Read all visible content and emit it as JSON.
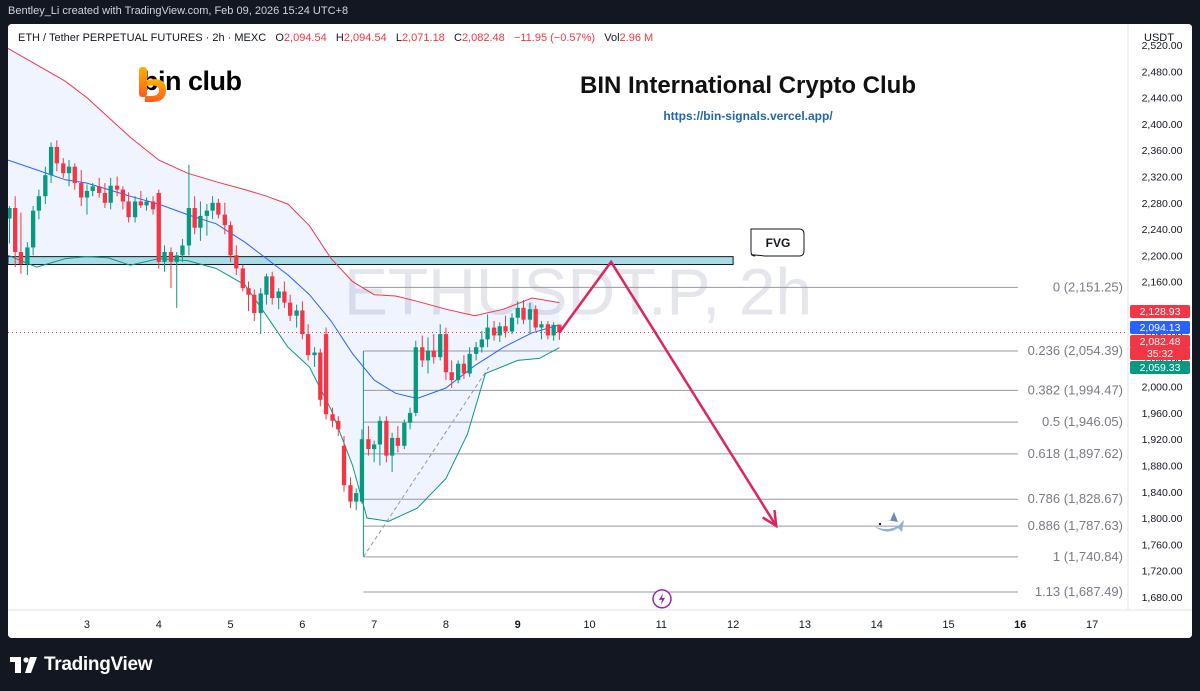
{
  "header": {
    "attribution": "Bentley_Li created with TradingView.com, Feb 09, 2026 15:24 UTC+8"
  },
  "legend": {
    "symbol": "ETH / Tether PERPETUAL FUTURES · 2h · MEXC",
    "open_label": "O",
    "open": "2,094.54",
    "high_label": "H",
    "high": "2,094.54",
    "low_label": "L",
    "low": "2,071.18",
    "close_label": "C",
    "close": "2,082.48",
    "change": "−11.95 (−0.57%)",
    "vol_label": "Vol",
    "vol": "2.96 M"
  },
  "brand": {
    "name": "bin club",
    "title": "BIN International Crypto Club",
    "url": "https://bin-signals.vercel.app/"
  },
  "currency": "USDT",
  "watermark": "ETHUSDT.P, 2h",
  "footer": {
    "logo_text": "TradingView"
  },
  "colors": {
    "up": "#089981",
    "down": "#f23645",
    "bb_upper": "#f23645",
    "bb_lower": "#089981",
    "bb_basis": "#2962ff",
    "fvg": "#a8dde7",
    "arrow": "#e0245e"
  },
  "chart_data": {
    "type": "candlestick",
    "title": "",
    "xlabel": "",
    "ylabel": "",
    "y_axis": {
      "ylim": [
        1660,
        2540
      ],
      "ticks": [
        1680,
        1720,
        1760,
        1800,
        1840,
        1880,
        1920,
        1960,
        2000,
        2040,
        2080,
        2120,
        2160,
        2200,
        2240,
        2280,
        2320,
        2360,
        2400,
        2440,
        2480,
        2520
      ],
      "tick_labels": [
        "1,680.00",
        "1,720.00",
        "1,760.00",
        "1,800.00",
        "1,840.00",
        "1,880.00",
        "1,920.00",
        "1,960.00",
        "2,000.00",
        "2,040.00",
        "2,080.00",
        "2,120.00",
        "2,160.00",
        "2,200.00",
        "2,240.00",
        "2,280.00",
        "2,320.00",
        "2,360.00",
        "2,400.00",
        "2,440.00",
        "2,480.00",
        "2,520.00"
      ]
    },
    "x_axis": {
      "ticks": [
        {
          "label": "3",
          "day": 3
        },
        {
          "label": "4",
          "day": 4
        },
        {
          "label": "5",
          "day": 5
        },
        {
          "label": "6",
          "day": 6
        },
        {
          "label": "7",
          "day": 7
        },
        {
          "label": "8",
          "day": 8
        },
        {
          "label": "9",
          "day": 9
        },
        {
          "label": "10",
          "day": 10
        },
        {
          "label": "11",
          "day": 11
        },
        {
          "label": "12",
          "day": 12
        },
        {
          "label": "13",
          "day": 13
        },
        {
          "label": "14",
          "day": 14
        },
        {
          "label": "15",
          "day": 15
        },
        {
          "label": "16",
          "day": 16
        },
        {
          "label": "17",
          "day": 17
        }
      ],
      "xlim_days": [
        1.9,
        17.5
      ]
    },
    "candles": [
      {
        "d": 1.92,
        "o": 2256,
        "h": 2275,
        "l": 2218,
        "c": 2272
      },
      {
        "d": 2.0,
        "o": 2272,
        "h": 2290,
        "l": 2182,
        "c": 2205
      },
      {
        "d": 2.08,
        "o": 2205,
        "h": 2265,
        "l": 2172,
        "c": 2187
      },
      {
        "d": 2.17,
        "o": 2187,
        "h": 2220,
        "l": 2170,
        "c": 2212
      },
      {
        "d": 2.25,
        "o": 2212,
        "h": 2275,
        "l": 2200,
        "c": 2268
      },
      {
        "d": 2.33,
        "o": 2268,
        "h": 2300,
        "l": 2255,
        "c": 2290
      },
      {
        "d": 2.42,
        "o": 2290,
        "h": 2335,
        "l": 2278,
        "c": 2322
      },
      {
        "d": 2.5,
        "o": 2322,
        "h": 2372,
        "l": 2310,
        "c": 2365
      },
      {
        "d": 2.58,
        "o": 2365,
        "h": 2375,
        "l": 2328,
        "c": 2340
      },
      {
        "d": 2.67,
        "o": 2340,
        "h": 2348,
        "l": 2318,
        "c": 2325
      },
      {
        "d": 2.75,
        "o": 2325,
        "h": 2345,
        "l": 2305,
        "c": 2335
      },
      {
        "d": 2.83,
        "o": 2335,
        "h": 2340,
        "l": 2300,
        "c": 2310
      },
      {
        "d": 2.92,
        "o": 2310,
        "h": 2330,
        "l": 2275,
        "c": 2288
      },
      {
        "d": 3.0,
        "o": 2288,
        "h": 2308,
        "l": 2262,
        "c": 2298
      },
      {
        "d": 3.08,
        "o": 2298,
        "h": 2310,
        "l": 2290,
        "c": 2305
      },
      {
        "d": 3.17,
        "o": 2305,
        "h": 2318,
        "l": 2288,
        "c": 2295
      },
      {
        "d": 3.25,
        "o": 2295,
        "h": 2310,
        "l": 2272,
        "c": 2280
      },
      {
        "d": 3.33,
        "o": 2280,
        "h": 2318,
        "l": 2270,
        "c": 2306
      },
      {
        "d": 3.42,
        "o": 2306,
        "h": 2320,
        "l": 2290,
        "c": 2300
      },
      {
        "d": 3.5,
        "o": 2300,
        "h": 2305,
        "l": 2270,
        "c": 2282
      },
      {
        "d": 3.58,
        "o": 2282,
        "h": 2296,
        "l": 2250,
        "c": 2258
      },
      {
        "d": 3.67,
        "o": 2258,
        "h": 2290,
        "l": 2250,
        "c": 2282
      },
      {
        "d": 3.75,
        "o": 2282,
        "h": 2298,
        "l": 2272,
        "c": 2276
      },
      {
        "d": 3.83,
        "o": 2276,
        "h": 2288,
        "l": 2268,
        "c": 2282
      },
      {
        "d": 3.92,
        "o": 2282,
        "h": 2290,
        "l": 2262,
        "c": 2270
      },
      {
        "d": 4.0,
        "o": 2295,
        "h": 2300,
        "l": 2180,
        "c": 2190
      },
      {
        "d": 4.08,
        "o": 2190,
        "h": 2215,
        "l": 2175,
        "c": 2205
      },
      {
        "d": 4.17,
        "o": 2205,
        "h": 2212,
        "l": 2150,
        "c": 2190
      },
      {
        "d": 4.25,
        "o": 2190,
        "h": 2205,
        "l": 2120,
        "c": 2200
      },
      {
        "d": 4.33,
        "o": 2200,
        "h": 2225,
        "l": 2190,
        "c": 2215
      },
      {
        "d": 4.42,
        "o": 2215,
        "h": 2338,
        "l": 2200,
        "c": 2272
      },
      {
        "d": 4.5,
        "o": 2272,
        "h": 2290,
        "l": 2232,
        "c": 2242
      },
      {
        "d": 4.58,
        "o": 2242,
        "h": 2282,
        "l": 2222,
        "c": 2260
      },
      {
        "d": 4.67,
        "o": 2260,
        "h": 2278,
        "l": 2230,
        "c": 2268
      },
      {
        "d": 4.75,
        "o": 2268,
        "h": 2290,
        "l": 2255,
        "c": 2280
      },
      {
        "d": 4.83,
        "o": 2280,
        "h": 2286,
        "l": 2256,
        "c": 2262
      },
      {
        "d": 4.92,
        "o": 2262,
        "h": 2280,
        "l": 2232,
        "c": 2246
      },
      {
        "d": 5.0,
        "o": 2246,
        "h": 2252,
        "l": 2190,
        "c": 2200
      },
      {
        "d": 5.08,
        "o": 2200,
        "h": 2215,
        "l": 2170,
        "c": 2180
      },
      {
        "d": 5.17,
        "o": 2180,
        "h": 2186,
        "l": 2145,
        "c": 2150
      },
      {
        "d": 5.25,
        "o": 2150,
        "h": 2160,
        "l": 2115,
        "c": 2140
      },
      {
        "d": 5.33,
        "o": 2140,
        "h": 2148,
        "l": 2100,
        "c": 2112
      },
      {
        "d": 5.42,
        "o": 2112,
        "h": 2150,
        "l": 2080,
        "c": 2142
      },
      {
        "d": 5.5,
        "o": 2140,
        "h": 2172,
        "l": 2125,
        "c": 2168
      },
      {
        "d": 5.58,
        "o": 2168,
        "h": 2175,
        "l": 2125,
        "c": 2135
      },
      {
        "d": 5.67,
        "o": 2135,
        "h": 2150,
        "l": 2118,
        "c": 2145
      },
      {
        "d": 5.75,
        "o": 2145,
        "h": 2160,
        "l": 2120,
        "c": 2128
      },
      {
        "d": 5.83,
        "o": 2128,
        "h": 2140,
        "l": 2100,
        "c": 2108
      },
      {
        "d": 5.92,
        "o": 2108,
        "h": 2125,
        "l": 2090,
        "c": 2116
      },
      {
        "d": 6.0,
        "o": 2116,
        "h": 2130,
        "l": 2072,
        "c": 2080
      },
      {
        "d": 6.08,
        "o": 2080,
        "h": 2095,
        "l": 2040,
        "c": 2048
      },
      {
        "d": 6.17,
        "o": 2048,
        "h": 2060,
        "l": 2030,
        "c": 2052
      },
      {
        "d": 6.25,
        "o": 2052,
        "h": 2058,
        "l": 1970,
        "c": 1980
      },
      {
        "d": 6.33,
        "o": 2080,
        "h": 2090,
        "l": 1950,
        "c": 1958
      },
      {
        "d": 6.42,
        "o": 1958,
        "h": 1968,
        "l": 1938,
        "c": 1948
      },
      {
        "d": 6.5,
        "o": 1948,
        "h": 1955,
        "l": 1925,
        "c": 1935
      },
      {
        "d": 6.58,
        "o": 1910,
        "h": 1925,
        "l": 1840,
        "c": 1850
      },
      {
        "d": 6.67,
        "o": 1850,
        "h": 1862,
        "l": 1815,
        "c": 1825
      },
      {
        "d": 6.75,
        "o": 1825,
        "h": 1845,
        "l": 1812,
        "c": 1838
      },
      {
        "d": 6.83,
        "o": 1825,
        "h": 1935,
        "l": 1822,
        "c": 1920
      },
      {
        "d": 6.92,
        "o": 1920,
        "h": 1940,
        "l": 1895,
        "c": 1905
      },
      {
        "d": 7.0,
        "o": 1905,
        "h": 1918,
        "l": 1885,
        "c": 1912
      },
      {
        "d": 7.08,
        "o": 1912,
        "h": 1955,
        "l": 1880,
        "c": 1948
      },
      {
        "d": 7.17,
        "o": 1948,
        "h": 1955,
        "l": 1885,
        "c": 1895
      },
      {
        "d": 7.25,
        "o": 1895,
        "h": 1930,
        "l": 1870,
        "c": 1922
      },
      {
        "d": 7.33,
        "o": 1922,
        "h": 1940,
        "l": 1900,
        "c": 1910
      },
      {
        "d": 7.42,
        "o": 1910,
        "h": 1950,
        "l": 1905,
        "c": 1945
      },
      {
        "d": 7.5,
        "o": 1945,
        "h": 1968,
        "l": 1935,
        "c": 1960
      },
      {
        "d": 7.58,
        "o": 1960,
        "h": 2070,
        "l": 1955,
        "c": 2060
      },
      {
        "d": 7.67,
        "o": 2060,
        "h": 2078,
        "l": 2030,
        "c": 2040
      },
      {
        "d": 7.75,
        "o": 2040,
        "h": 2075,
        "l": 2020,
        "c": 2055
      },
      {
        "d": 7.83,
        "o": 2055,
        "h": 2080,
        "l": 2035,
        "c": 2045
      },
      {
        "d": 7.92,
        "o": 2045,
        "h": 2095,
        "l": 2040,
        "c": 2080
      },
      {
        "d": 8.0,
        "o": 2080,
        "h": 2090,
        "l": 2010,
        "c": 2022
      },
      {
        "d": 8.08,
        "o": 2022,
        "h": 2040,
        "l": 1998,
        "c": 2010
      },
      {
        "d": 8.17,
        "o": 2010,
        "h": 2040,
        "l": 2005,
        "c": 2035
      },
      {
        "d": 8.25,
        "o": 2035,
        "h": 2048,
        "l": 2012,
        "c": 2020
      },
      {
        "d": 8.33,
        "o": 2020,
        "h": 2060,
        "l": 2015,
        "c": 2050
      },
      {
        "d": 8.42,
        "o": 2050,
        "h": 2068,
        "l": 2040,
        "c": 2060
      },
      {
        "d": 8.5,
        "o": 2060,
        "h": 2085,
        "l": 2052,
        "c": 2072
      },
      {
        "d": 8.58,
        "o": 2072,
        "h": 2110,
        "l": 2060,
        "c": 2090
      },
      {
        "d": 8.67,
        "o": 2090,
        "h": 2100,
        "l": 2070,
        "c": 2078
      },
      {
        "d": 8.75,
        "o": 2078,
        "h": 2098,
        "l": 2068,
        "c": 2092
      },
      {
        "d": 8.83,
        "o": 2092,
        "h": 2108,
        "l": 2075,
        "c": 2084
      },
      {
        "d": 8.92,
        "o": 2084,
        "h": 2112,
        "l": 2080,
        "c": 2105
      },
      {
        "d": 9.0,
        "o": 2105,
        "h": 2130,
        "l": 2095,
        "c": 2120
      },
      {
        "d": 9.08,
        "o": 2120,
        "h": 2132,
        "l": 2095,
        "c": 2102
      },
      {
        "d": 9.17,
        "o": 2102,
        "h": 2128,
        "l": 2080,
        "c": 2118
      },
      {
        "d": 9.25,
        "o": 2118,
        "h": 2124,
        "l": 2085,
        "c": 2090
      },
      {
        "d": 9.33,
        "o": 2090,
        "h": 2100,
        "l": 2072,
        "c": 2095
      },
      {
        "d": 9.42,
        "o": 2095,
        "h": 2100,
        "l": 2072,
        "c": 2078
      },
      {
        "d": 9.5,
        "o": 2078,
        "h": 2098,
        "l": 2070,
        "c": 2094
      },
      {
        "d": 9.58,
        "o": 2094.54,
        "h": 2094.54,
        "l": 2071.18,
        "c": 2082.48
      }
    ],
    "bollinger": {
      "upper": [
        [
          1.9,
          2515
        ],
        [
          2.3,
          2490
        ],
        [
          2.7,
          2465
        ],
        [
          3.0,
          2440
        ],
        [
          3.3,
          2410
        ],
        [
          3.6,
          2380
        ],
        [
          4.0,
          2345
        ],
        [
          4.4,
          2325
        ],
        [
          4.8,
          2312
        ],
        [
          5.2,
          2300
        ],
        [
          5.5,
          2290
        ],
        [
          5.8,
          2278
        ],
        [
          6.1,
          2245
        ],
        [
          6.4,
          2195
        ],
        [
          6.7,
          2160
        ],
        [
          7.0,
          2140
        ],
        [
          7.3,
          2138
        ],
        [
          7.6,
          2130
        ],
        [
          8.0,
          2118
        ],
        [
          8.4,
          2108
        ],
        [
          8.8,
          2118
        ],
        [
          9.2,
          2135
        ],
        [
          9.58,
          2128
        ]
      ],
      "basis": [
        [
          1.9,
          2345
        ],
        [
          2.3,
          2330
        ],
        [
          2.7,
          2315
        ],
        [
          3.0,
          2310
        ],
        [
          3.3,
          2300
        ],
        [
          3.6,
          2290
        ],
        [
          4.0,
          2278
        ],
        [
          4.4,
          2262
        ],
        [
          4.8,
          2248
        ],
        [
          5.2,
          2220
        ],
        [
          5.5,
          2195
        ],
        [
          5.8,
          2170
        ],
        [
          6.1,
          2140
        ],
        [
          6.4,
          2100
        ],
        [
          6.7,
          2050
        ],
        [
          7.0,
          2010
        ],
        [
          7.3,
          1990
        ],
        [
          7.6,
          1982
        ],
        [
          8.0,
          1998
        ],
        [
          8.4,
          2032
        ],
        [
          8.8,
          2060
        ],
        [
          9.2,
          2082
        ],
        [
          9.58,
          2094.13
        ]
      ],
      "lower": [
        [
          1.9,
          2200
        ],
        [
          2.3,
          2182
        ],
        [
          2.7,
          2195
        ],
        [
          3.0,
          2198
        ],
        [
          3.3,
          2196
        ],
        [
          3.6,
          2185
        ],
        [
          4.0,
          2195
        ],
        [
          4.4,
          2192
        ],
        [
          4.8,
          2180
        ],
        [
          5.2,
          2155
        ],
        [
          5.5,
          2108
        ],
        [
          5.8,
          2060
        ],
        [
          6.1,
          2030
        ],
        [
          6.4,
          1965
        ],
        [
          6.7,
          1880
        ],
        [
          6.9,
          1800
        ],
        [
          7.2,
          1795
        ],
        [
          7.6,
          1815
        ],
        [
          8.0,
          1860
        ],
        [
          8.3,
          1928
        ],
        [
          8.55,
          2020
        ],
        [
          9.0,
          2040
        ],
        [
          9.3,
          2043
        ],
        [
          9.58,
          2059.33
        ]
      ]
    },
    "fvg": {
      "label": "FVG",
      "top": 2198,
      "bottom": 2186,
      "x_start_day": 1.9,
      "x_end_day": 12.0
    },
    "fibonacci": {
      "start_day": 6.85,
      "levels": [
        {
          "ratio": "0",
          "price": 2151.25,
          "label": "0 (2,151.25)"
        },
        {
          "ratio": "0.236",
          "price": 2054.39,
          "label": "0.236 (2,054.39)"
        },
        {
          "ratio": "0.382",
          "price": 1994.47,
          "label": "0.382 (1,994.47)"
        },
        {
          "ratio": "0.5",
          "price": 1946.05,
          "label": "0.5 (1,946.05)"
        },
        {
          "ratio": "0.618",
          "price": 1897.62,
          "label": "0.618 (1,897.62)"
        },
        {
          "ratio": "0.786",
          "price": 1828.67,
          "label": "0.786 (1,828.67)"
        },
        {
          "ratio": "0.886",
          "price": 1787.63,
          "label": "0.886 (1,787.63)"
        },
        {
          "ratio": "1",
          "price": 1740.84,
          "label": "1 (1,740.84)"
        },
        {
          "ratio": "1.13",
          "price": 1687.49,
          "label": "1.13 (1,687.49)"
        }
      ]
    },
    "projection": [
      [
        9.58,
        2082.48
      ],
      [
        10.3,
        2190
      ],
      [
        12.6,
        1788
      ]
    ],
    "trendline": [
      [
        6.85,
        1740.84
      ],
      [
        8.6,
        2030
      ]
    ],
    "price_labels": [
      {
        "text": "2,128.93",
        "price": 2128.93,
        "color": "#f23645"
      },
      {
        "text": "2,094.13",
        "price": 2094.13,
        "color": "#2962ff"
      },
      {
        "text": "2,082.48",
        "price": 2082.48,
        "color": "#f23645"
      },
      {
        "text": "35:32",
        "price": 2070.5,
        "color": "#f23645"
      },
      {
        "text": "2,059.33",
        "price": 2059.33,
        "color": "#089981"
      }
    ],
    "current_price": 2082.48
  }
}
